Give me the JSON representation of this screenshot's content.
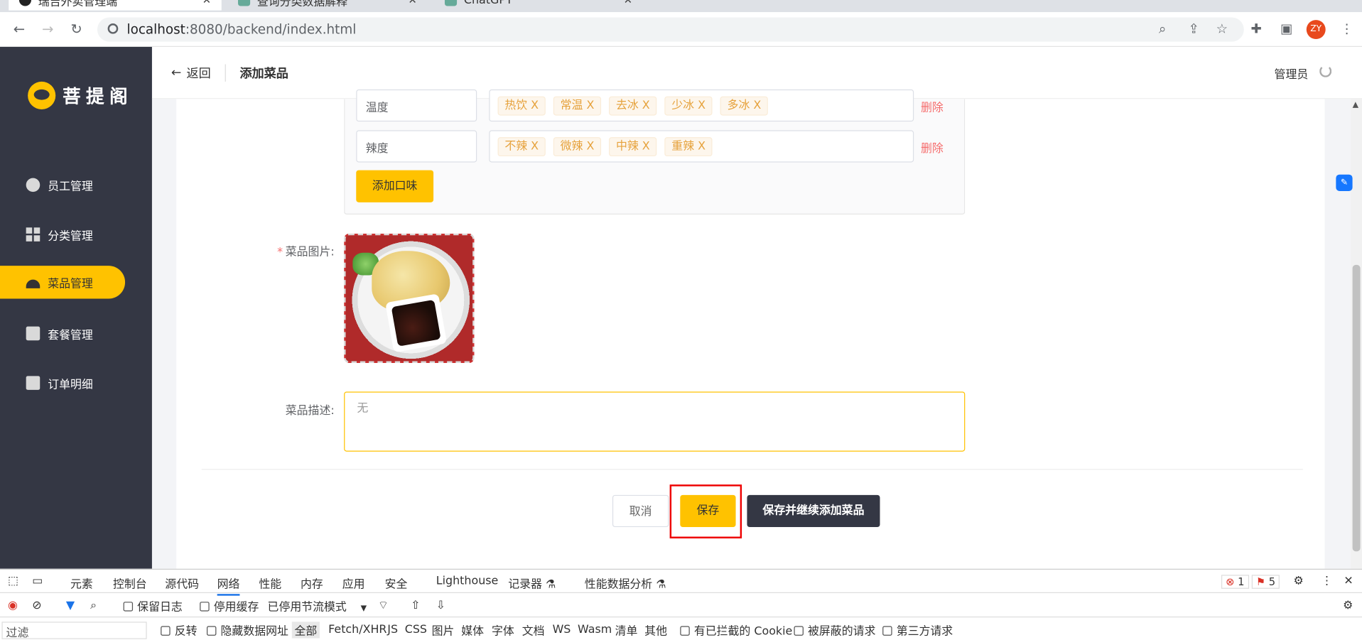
{
  "browser": {
    "tabs": [
      {
        "title": "瑞吉外卖管理端",
        "active": true
      },
      {
        "title": "查询分类数据解释",
        "active": false
      },
      {
        "title": "ChatGPT",
        "active": false
      }
    ],
    "url_host": "localhost",
    "url_rest": ":8080/backend/index.html",
    "profile": "ZY"
  },
  "sidebar": {
    "logo_text": "菩提阁",
    "items": [
      {
        "label": "员工管理",
        "icon": "user-icon"
      },
      {
        "label": "分类管理",
        "icon": "grid-icon"
      },
      {
        "label": "菜品管理",
        "icon": "dish-cover-icon",
        "active": true
      },
      {
        "label": "套餐管理",
        "icon": "gift-icon"
      },
      {
        "label": "订单明细",
        "icon": "clipboard-icon"
      }
    ]
  },
  "header": {
    "back_label": "返回",
    "title": "添加菜品",
    "user": "管理员"
  },
  "form": {
    "flavors": [
      {
        "name": "温度",
        "tags": [
          "热饮 X",
          "常温 X",
          "去冰 X",
          "少冰 X",
          "多冰 X"
        ],
        "delete_label": "删除"
      },
      {
        "name": "辣度",
        "tags": [
          "不辣 X",
          "微辣 X",
          "中辣 X",
          "重辣 X"
        ],
        "delete_label": "删除"
      }
    ],
    "add_flavor_label": "添加口味",
    "image_label": "菜品图片:",
    "required_mark": "*",
    "desc_label": "菜品描述:",
    "desc_value": "无",
    "cancel_label": "取消",
    "save_label": "保存",
    "save_continue_label": "保存并继续添加菜品"
  },
  "devtools": {
    "tabs": [
      "元素",
      "控制台",
      "源代码",
      "网络",
      "性能",
      "内存",
      "应用",
      "安全",
      "Lighthouse",
      "记录器 ⚗",
      "性能数据分析 ⚗"
    ],
    "active_tab": "网络",
    "errors": "1",
    "issues": "5",
    "preserve_log": "保留日志",
    "disable_cache": "停用缓存",
    "throttle": "已停用节流模式",
    "filter_placeholder": "过滤",
    "invert": "反转",
    "hide_data_urls": "隐藏数据网址",
    "types": [
      "全部",
      "Fetch/XHR",
      "JS",
      "CSS",
      "图片",
      "媒体",
      "字体",
      "文档",
      "WS",
      "Wasm",
      "清单",
      "其他"
    ],
    "blocked_cookies": "有已拦截的 Cookie",
    "blocked_requests": "被屏蔽的请求",
    "third_party": "第三方请求"
  }
}
